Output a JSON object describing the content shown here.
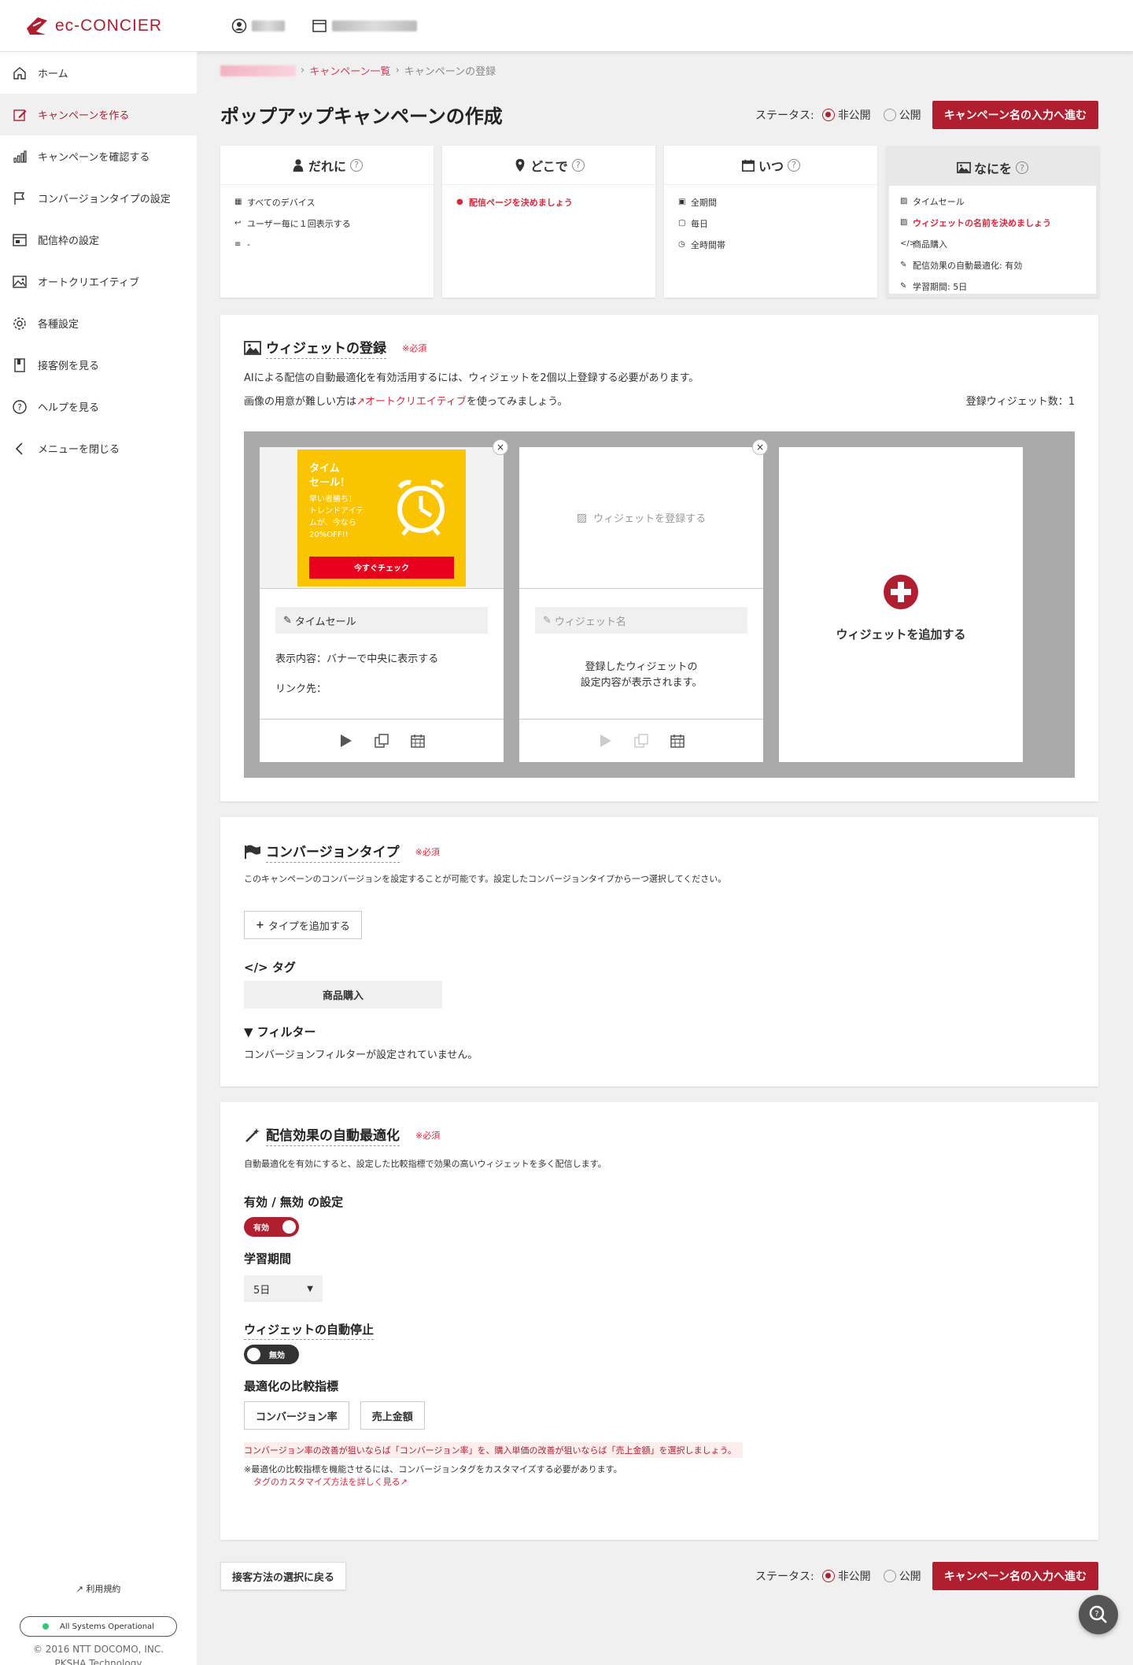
{
  "header": {
    "brand": "ec-CONCIER"
  },
  "sidebar": {
    "items": [
      {
        "label": "ホーム",
        "icon": "home-icon"
      },
      {
        "label": "キャンペーンを作る",
        "icon": "edit-icon"
      },
      {
        "label": "キャンペーンを確認する",
        "icon": "bar-chart-icon"
      },
      {
        "label": "コンバージョンタイプの設定",
        "icon": "flag-icon"
      },
      {
        "label": "配信枠の設定",
        "icon": "layout-icon"
      },
      {
        "label": "オートクリエイティブ",
        "icon": "image-icon"
      },
      {
        "label": "各種設定",
        "icon": "gear-icon"
      },
      {
        "label": "接客例を見る",
        "icon": "book-icon"
      },
      {
        "label": "ヘルプを見る",
        "icon": "help-icon"
      },
      {
        "label": "メニューを閉じる",
        "icon": "chevron-left-icon"
      }
    ],
    "terms": "利用規約",
    "system_status": "All Systems Operational",
    "copyright": "© 2016 NTT DOCOMO, INC.",
    "company": "PKSHA Technology"
  },
  "breadcrumb": {
    "campaign_list": "キャンペーン一覧",
    "current": "キャンペーンの登録"
  },
  "page": {
    "title": "ポップアップキャンペーンの作成",
    "status_label": "ステータス:",
    "status_private": "非公開",
    "status_public": "公開",
    "next_button": "キャンペーン名の入力へ進む",
    "back_button": "接客方法の選択に戻る"
  },
  "cards": {
    "who": {
      "title": "だれに",
      "items": [
        "すべてのデバイス",
        "ユーザー毎に１回表示する",
        "-"
      ]
    },
    "where": {
      "title": "どこで",
      "items": [
        "配信ページを決めましょう"
      ]
    },
    "when": {
      "title": "いつ",
      "items": [
        "全期間",
        "毎日",
        "全時間帯"
      ]
    },
    "what": {
      "title": "なにを",
      "items": [
        "タイムセール",
        "ウィジェットの名前を決めましょう",
        "商品購入",
        "配信効果の自動最適化: 有効",
        "学習期間: 5日"
      ]
    }
  },
  "widget_section": {
    "title": "ウィジェットの登録",
    "required": "※必須",
    "desc1": "AIによる配信の自動最適化を有効活用するには、ウィジェットを2個以上登録する必要があります。",
    "desc2_pre": "画像の用意が難しい方は",
    "desc2_link": "オートクリエイティブ",
    "desc2_post": "を使ってみましょう。",
    "count_label": "登録ウィジェット数：1",
    "widget1": {
      "banner_title": "タイム\nセール！",
      "banner_body": "早い者勝ち！\nトレンドアイテ\nムが、今なら\n20%OFF!!",
      "banner_cta": "今すぐチェック",
      "name": "タイムセール",
      "display": "表示内容：バナーで中央に表示する",
      "link": "リンク先："
    },
    "widget2": {
      "register_label": "ウィジェットを登録する",
      "name_placeholder": "ウィジェット名",
      "info": "登録したウィジェットの\n設定内容が表示されます。"
    },
    "add_label": "ウィジェットを追加する"
  },
  "conversion_section": {
    "title": "コンバージョンタイプ",
    "required": "※必須",
    "desc": "このキャンペーンのコンバージョンを設定することが可能です。設定したコンバージョンタイプから一つ選択してください。",
    "add_type": "タイプを追加する",
    "tag_heading": "タグ",
    "tag_value": "商品購入",
    "filter_heading": "フィルター",
    "filter_desc": "コンバージョンフィルターが設定されていません。"
  },
  "optimize_section": {
    "title": "配信効果の自動最適化",
    "required": "※必須",
    "desc": "自動最適化を有効にすると、設定した比較指標で効果の高いウィジェットを多く配信します。",
    "enable_heading": "有効 / 無効 の設定",
    "enable_toggle": "有効",
    "period_heading": "学習期間",
    "period_value": "5日",
    "autostop_heading": "ウィジェットの自動停止",
    "autostop_toggle": "無効",
    "metric_heading": "最適化の比較指標",
    "metric1": "コンバージョン率",
    "metric2": "売上金額",
    "metric_hint": "コンバージョン率の改善が狙いならば「コンバージョン率」を、購入単価の改善が狙いならば「売上金額」を選択しましょう。",
    "note": "※最適化の比較指標を機能させるには、コンバージョンタグをカスタマイズする必要があります。",
    "note_link": "タグのカスタマイズ方法を詳しく見る"
  },
  "colors": {
    "brand": "#b01e2f",
    "accent_red": "#e0253a",
    "yellow": "#fbc400"
  }
}
